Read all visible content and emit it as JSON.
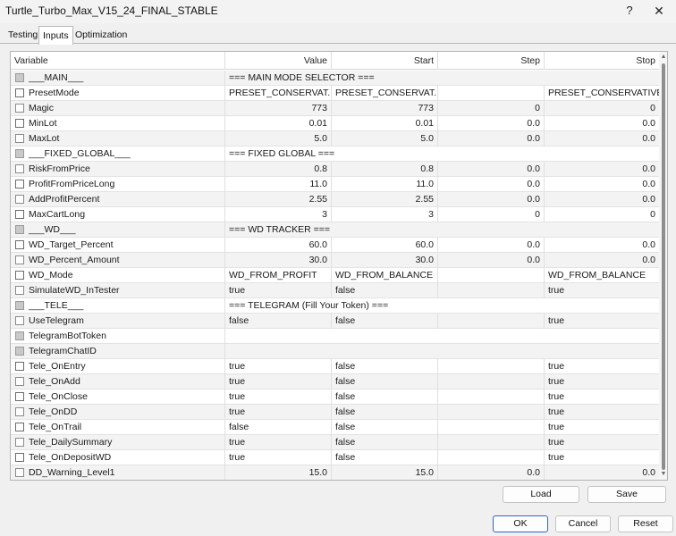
{
  "window": {
    "title": "Turtle_Turbo_Max_V15_24_FINAL_STABLE",
    "help_glyph": "?",
    "close_glyph": "✕"
  },
  "tabs": [
    {
      "label": "Testing"
    },
    {
      "label": "Inputs"
    },
    {
      "label": "Optimization"
    }
  ],
  "grid": {
    "columns": {
      "variable": "Variable",
      "value": "Value",
      "start": "Start",
      "step": "Step",
      "stop": "Stop"
    },
    "rows": [
      {
        "type": "sep",
        "name": "___MAIN___",
        "text": "=== MAIN MODE SELECTOR ==="
      },
      {
        "type": "str",
        "name": "PresetMode",
        "value": "PRESET_CONSERVAT...",
        "start": "PRESET_CONSERVAT...",
        "step": "",
        "stop": "PRESET_CONSERVATIVE"
      },
      {
        "type": "num",
        "name": "Magic",
        "value": "773",
        "start": "773",
        "step": "0",
        "stop": "0"
      },
      {
        "type": "num",
        "name": "MinLot",
        "value": "0.01",
        "start": "0.01",
        "step": "0.0",
        "stop": "0.0"
      },
      {
        "type": "num",
        "name": "MaxLot",
        "value": "5.0",
        "start": "5.0",
        "step": "0.0",
        "stop": "0.0"
      },
      {
        "type": "sep",
        "name": "___FIXED_GLOBAL___",
        "text": "=== FIXED GLOBAL ==="
      },
      {
        "type": "num",
        "name": "RiskFromPrice",
        "value": "0.8",
        "start": "0.8",
        "step": "0.0",
        "stop": "0.0"
      },
      {
        "type": "num",
        "name": "ProfitFromPriceLong",
        "value": "11.0",
        "start": "11.0",
        "step": "0.0",
        "stop": "0.0"
      },
      {
        "type": "num",
        "name": "AddProfitPercent",
        "value": "2.55",
        "start": "2.55",
        "step": "0.0",
        "stop": "0.0"
      },
      {
        "type": "num",
        "name": "MaxCartLong",
        "value": "3",
        "start": "3",
        "step": "0",
        "stop": "0"
      },
      {
        "type": "sep",
        "name": "___WD___",
        "text": "=== WD TRACKER ==="
      },
      {
        "type": "num",
        "name": "WD_Target_Percent",
        "value": "60.0",
        "start": "60.0",
        "step": "0.0",
        "stop": "0.0"
      },
      {
        "type": "num",
        "name": "WD_Percent_Amount",
        "value": "30.0",
        "start": "30.0",
        "step": "0.0",
        "stop": "0.0"
      },
      {
        "type": "str",
        "name": "WD_Mode",
        "value": "WD_FROM_PROFIT",
        "start": "WD_FROM_BALANCE",
        "step": "",
        "stop": "WD_FROM_BALANCE"
      },
      {
        "type": "str",
        "name": "SimulateWD_InTester",
        "value": "true",
        "start": "false",
        "step": "",
        "stop": "true"
      },
      {
        "type": "sep",
        "name": "___TELE___",
        "text": "=== TELEGRAM (Fill Your Token) ==="
      },
      {
        "type": "str",
        "name": "UseTelegram",
        "value": "false",
        "start": "false",
        "step": "",
        "stop": "true"
      },
      {
        "type": "sepblank",
        "name": "TelegramBotToken",
        "text": ""
      },
      {
        "type": "sepblank",
        "name": "TelegramChatID",
        "text": ""
      },
      {
        "type": "str",
        "name": "Tele_OnEntry",
        "value": "true",
        "start": "false",
        "step": "",
        "stop": "true"
      },
      {
        "type": "str",
        "name": "Tele_OnAdd",
        "value": "true",
        "start": "false",
        "step": "",
        "stop": "true"
      },
      {
        "type": "str",
        "name": "Tele_OnClose",
        "value": "true",
        "start": "false",
        "step": "",
        "stop": "true"
      },
      {
        "type": "str",
        "name": "Tele_OnDD",
        "value": "true",
        "start": "false",
        "step": "",
        "stop": "true"
      },
      {
        "type": "str",
        "name": "Tele_OnTrail",
        "value": "false",
        "start": "false",
        "step": "",
        "stop": "true"
      },
      {
        "type": "str",
        "name": "Tele_DailySummary",
        "value": "true",
        "start": "false",
        "step": "",
        "stop": "true"
      },
      {
        "type": "str",
        "name": "Tele_OnDepositWD",
        "value": "true",
        "start": "false",
        "step": "",
        "stop": "true"
      },
      {
        "type": "num",
        "name": "DD_Warning_Level1",
        "value": "15.0",
        "start": "15.0",
        "step": "0.0",
        "stop": "0.0"
      }
    ]
  },
  "buttons": {
    "load": "Load",
    "save": "Save",
    "ok": "OK",
    "cancel": "Cancel",
    "reset": "Reset"
  }
}
